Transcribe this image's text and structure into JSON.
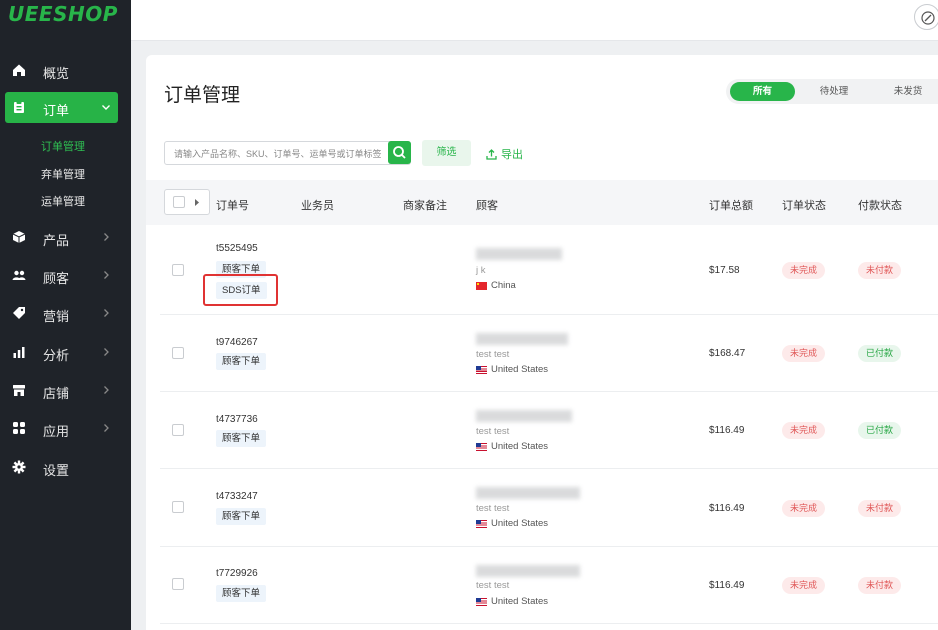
{
  "app": {
    "logo": "UEESHOP"
  },
  "sidebar": {
    "items": [
      {
        "label": "概览",
        "icon": "home-icon"
      },
      {
        "label": "订单",
        "icon": "clipboard-icon"
      },
      {
        "label": "产品",
        "icon": "box-icon"
      },
      {
        "label": "顾客",
        "icon": "users-icon"
      },
      {
        "label": "营销",
        "icon": "tag-icon"
      },
      {
        "label": "分析",
        "icon": "bar-chart-icon"
      },
      {
        "label": "店铺",
        "icon": "store-icon"
      },
      {
        "label": "应用",
        "icon": "apps-icon"
      },
      {
        "label": "设置",
        "icon": "gear-icon"
      }
    ],
    "order_sub": [
      {
        "label": "订单管理"
      },
      {
        "label": "弃单管理"
      },
      {
        "label": "运单管理"
      }
    ]
  },
  "page": {
    "title": "订单管理"
  },
  "tabs": [
    {
      "label": "所有"
    },
    {
      "label": "待处理"
    },
    {
      "label": "未发货"
    }
  ],
  "search": {
    "placeholder": "请输入产品名称、SKU、订单号、运单号或订单标签"
  },
  "toolbar": {
    "filter_label": "筛选",
    "export_label": "导出"
  },
  "table": {
    "headers": {
      "order_no": "订单号",
      "salesperson": "业务员",
      "merchant_note": "商家备注",
      "customer": "顾客",
      "total": "订单总额",
      "order_status": "订单状态",
      "payment_status": "付款状态"
    },
    "rows": [
      {
        "order_no": "t5525495",
        "tags": [
          "顾客下单",
          "SDS订单"
        ],
        "customer_name": "j k",
        "country": "China",
        "total": "$17.58",
        "order_status": "未完成",
        "payment_status": "未付款"
      },
      {
        "order_no": "t9746267",
        "tags": [
          "顾客下单"
        ],
        "customer_name": "test test",
        "country": "United States",
        "total": "$168.47",
        "order_status": "未完成",
        "payment_status": "已付款"
      },
      {
        "order_no": "t4737736",
        "tags": [
          "顾客下单"
        ],
        "customer_name": "test test",
        "country": "United States",
        "total": "$116.49",
        "order_status": "未完成",
        "payment_status": "已付款"
      },
      {
        "order_no": "t4733247",
        "tags": [
          "顾客下单"
        ],
        "customer_name": "test test",
        "country": "United States",
        "total": "$116.49",
        "order_status": "未完成",
        "payment_status": "未付款"
      },
      {
        "order_no": "t7729926",
        "tags": [
          "顾客下单"
        ],
        "customer_name": "test test",
        "country": "United States",
        "total": "$116.49",
        "order_status": "未完成",
        "payment_status": "未付款"
      }
    ]
  },
  "colors": {
    "brand": "#28b54a",
    "sidebar_bg": "#1f2329",
    "highlight": "#e03333"
  }
}
